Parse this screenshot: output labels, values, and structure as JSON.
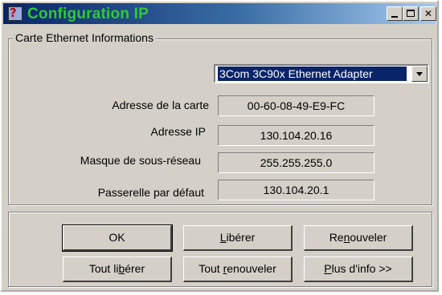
{
  "window": {
    "title": "Configuration IP"
  },
  "titlebar_buttons": {
    "minimize": "minimize",
    "maximize": "maximize",
    "close": "✕"
  },
  "group": {
    "label": "Carte Ethernet  Informations"
  },
  "adapter": {
    "selected": "3Com 3C90x Ethernet Adapter"
  },
  "fields": [
    {
      "label": "Adresse de la carte",
      "value": "00-60-08-49-E9-FC"
    },
    {
      "label": "Adresse IP",
      "value": "130.104.20.16"
    },
    {
      "label": "Masque de sous-réseau",
      "value": "255.255.255.0"
    },
    {
      "label": "Passerelle par défaut",
      "value": "130.104.20.1"
    }
  ],
  "buttons": {
    "ok": "OK",
    "release": {
      "pre": "",
      "u": "L",
      "post": "ibérer"
    },
    "renew": {
      "pre": "Re",
      "u": "n",
      "post": "ouveler"
    },
    "release_all": {
      "pre": "Tout li",
      "u": "b",
      "post": "érer"
    },
    "renew_all": {
      "pre": "Tout ",
      "u": "r",
      "post": "enouveler"
    },
    "more_info": {
      "pre": "",
      "u": "P",
      "post": "lus d'info >>"
    }
  }
}
